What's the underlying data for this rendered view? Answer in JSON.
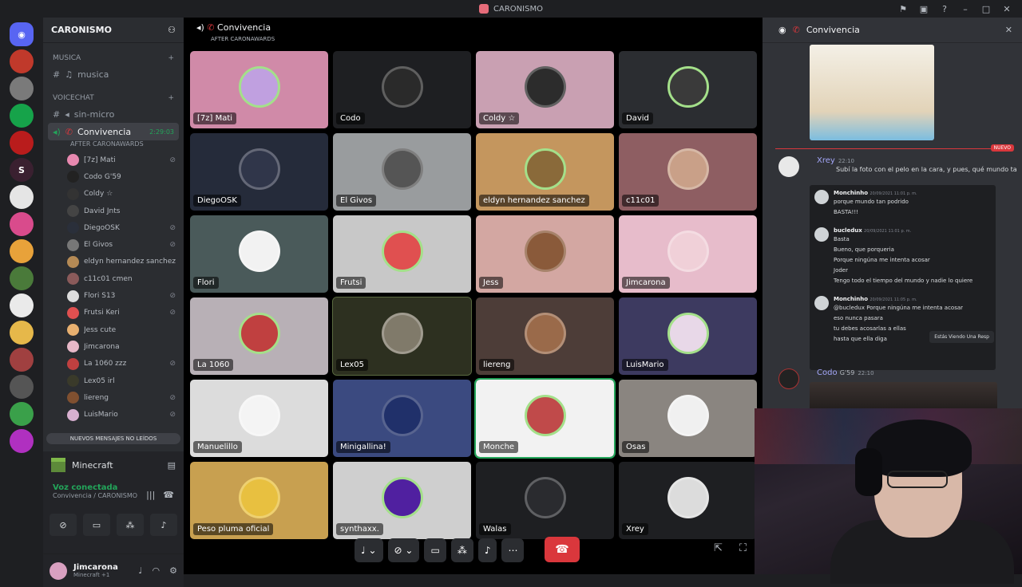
{
  "window": {
    "title": "CARONISMO"
  },
  "servers": [
    {
      "label": "",
      "color": "#5865f2"
    },
    {
      "label": "",
      "color": "#c0392b"
    },
    {
      "label": "",
      "color": "#7a7a7a"
    },
    {
      "label": "",
      "color": "#16a34a"
    },
    {
      "label": "",
      "color": "#b91c1c"
    },
    {
      "label": "S",
      "color": "#3a2030"
    },
    {
      "label": "",
      "color": "#e5e5e5"
    },
    {
      "label": "",
      "color": "#d94b8c"
    },
    {
      "label": "",
      "color": "#e8a23a"
    },
    {
      "label": "",
      "color": "#4a7a3a"
    },
    {
      "label": "",
      "color": "#eaeaea"
    },
    {
      "label": "",
      "color": "#e6b84a"
    },
    {
      "label": "",
      "color": "#a04040"
    },
    {
      "label": "",
      "color": "#555"
    },
    {
      "label": "",
      "color": "#3aa04a"
    },
    {
      "label": "",
      "color": "#b030c0"
    }
  ],
  "guild": {
    "name": "CARONISMO"
  },
  "categories": {
    "musica": "MUSICA",
    "voicechat": "VOICECHAT"
  },
  "channels": {
    "musica": "musica",
    "sin_micro": "sin-micro",
    "convivencia": "Convivencia",
    "convivencia_time": "2:29:03",
    "convivencia_status": "AFTER CARONAWARDS"
  },
  "voice_users": [
    {
      "name": "[7z] Mati",
      "color": "#e889b0",
      "muted": true
    },
    {
      "name": "Codo  G'59",
      "color": "#222",
      "muted": false
    },
    {
      "name": "Coldy ☆",
      "color": "#333",
      "muted": false
    },
    {
      "name": "David  Jnts",
      "color": "#444",
      "muted": false
    },
    {
      "name": "DiegoOSK",
      "color": "#2a2f3a",
      "muted": true
    },
    {
      "name": "El Givos",
      "color": "#777",
      "muted": true
    },
    {
      "name": "eldyn hernandez sanchez",
      "color": "#b58a55",
      "muted": false
    },
    {
      "name": "c11c01  cmen",
      "color": "#8a5a5a",
      "muted": false
    },
    {
      "name": "Flori  S13",
      "color": "#ddd",
      "muted": true
    },
    {
      "name": "Frutsi  Keri",
      "color": "#e05050",
      "muted": true
    },
    {
      "name": "Jess  cute",
      "color": "#e8b070",
      "muted": false
    },
    {
      "name": "Jimcarona",
      "color": "#e8b8c8",
      "muted": false
    },
    {
      "name": "La 1060  zzz",
      "color": "#c04040",
      "muted": true
    },
    {
      "name": "Lex05  irl",
      "color": "#3a3a2a",
      "muted": false
    },
    {
      "name": "liereng",
      "color": "#805030",
      "muted": true
    },
    {
      "name": "LuisMario",
      "color": "#d8b0d0",
      "muted": true
    }
  ],
  "new_messages": "NUEVOS MENSAJES NO LEÍDOS",
  "panel": {
    "minecraft": "Minecraft",
    "voice_status": "Voz conectada",
    "voice_location": "Convivencia / CARONISMO",
    "user_name": "Jimcarona",
    "user_status": "Minecraft +1"
  },
  "call": {
    "title": "Convivencia",
    "subtitle": "AFTER CARONAWARDS"
  },
  "tiles": [
    {
      "name": "[7z] Mati",
      "bg": "#d08aa8",
      "ring": "#c0a0e0"
    },
    {
      "name": "Codo",
      "bg": "#1e1f22",
      "ring": "#2a2a2a"
    },
    {
      "name": "Coldy ☆",
      "bg": "#c9a0b2",
      "ring": "#2c2c2c"
    },
    {
      "name": "David",
      "bg": "#2b2d31",
      "ring": "#3a3a3a"
    },
    {
      "name": "DiegoOSK",
      "bg": "#252b3a",
      "ring": "#30364a"
    },
    {
      "name": "El Givos",
      "bg": "#999c9e",
      "ring": "#555"
    },
    {
      "name": "eldyn hernandez sanchez",
      "bg": "#c4965e",
      "ring": "#8a6a3a"
    },
    {
      "name": "c11c01",
      "bg": "#8e5e62",
      "ring": "#c9a088"
    },
    {
      "name": "Flori",
      "bg": "#4a5a5a",
      "ring": "#f2f2f2"
    },
    {
      "name": "Frutsi",
      "bg": "#c8c8c8",
      "ring": "#e05050"
    },
    {
      "name": "Jess",
      "bg": "#d3a7a2",
      "ring": "#8a5a3a"
    },
    {
      "name": "Jimcarona",
      "bg": "#e7bccb",
      "ring": "#f0d0d8"
    },
    {
      "name": "La 1060",
      "bg": "#b8b0b6",
      "ring": "#c04040"
    },
    {
      "name": "Lex05",
      "bg": "#2d3020",
      "ring": "#807a6a"
    },
    {
      "name": "liereng",
      "bg": "#4d3d38",
      "ring": "#9a6a4a"
    },
    {
      "name": "LuisMario",
      "bg": "#3d3a60",
      "ring": "#e8d8e8"
    },
    {
      "name": "Manuelillo",
      "bg": "#dcdcdc",
      "ring": "#f4f4f4"
    },
    {
      "name": "Minigallina!",
      "bg": "#3b4a80",
      "ring": "#20306a"
    },
    {
      "name": "Monche",
      "bg": "#f2f2f2",
      "ring": "#c04a4a"
    },
    {
      "name": "Osas",
      "bg": "#8a8580",
      "ring": "#f0f0f0"
    },
    {
      "name": "Peso pluma oficial",
      "bg": "#c8a050",
      "ring": "#e8c040"
    },
    {
      "name": "synthaxx.",
      "bg": "#cfcfcf",
      "ring": "#5020a0"
    },
    {
      "name": "Walas",
      "bg": "#1e1f22",
      "ring": "#2a2b2f"
    },
    {
      "name": "Xrey",
      "bg": "#1e1f22",
      "ring": "#dcdcdc"
    }
  ],
  "chat": {
    "header": "Convivencia",
    "new_tag": "NUEVO",
    "m1": {
      "user": "Xrey",
      "time": "22:10",
      "text": "Subí la foto con el pelo en la cara, y pues, qué mundo ta",
      "name_color": "#a3a6f8"
    },
    "shot": [
      {
        "user": "Monchinho",
        "time": "20/09/2021 11:01 p. m.",
        "lines": [
          "porque mundo tan podrido",
          "BASTA!!!"
        ]
      },
      {
        "user": "bucledux",
        "time": "20/09/2021 11:01 p. m.",
        "lines": [
          "Basta",
          "Bueno, que porqueria",
          "Porque ningúna me intenta acosar",
          "Joder",
          "Tengo todo el tiempo del mundo y nadie lo quiere"
        ]
      },
      {
        "user": "Monchinho",
        "time": "20/09/2021 11:05 p. m.",
        "lines": [
          "@bucledux Porque ningúna me intenta acosar",
          "eso nunca pasara",
          "tu debes acosarlas a ellas",
          "hasta que ella diga"
        ]
      }
    ],
    "hover_tip": "Estás Viendo Una Resp",
    "m2": {
      "user": "Codo",
      "badge": "G'59",
      "time": "22:10",
      "name_color": "#a3a6f8"
    }
  }
}
